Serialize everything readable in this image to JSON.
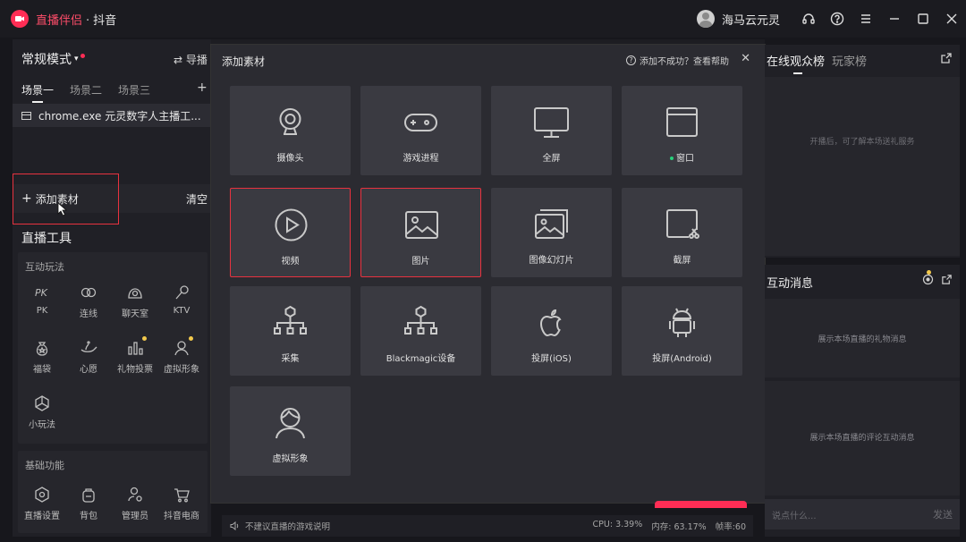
{
  "titlebar": {
    "brand": "直播伴侣",
    "separator": "·",
    "platform": "抖音",
    "username": "海马云元灵"
  },
  "left": {
    "mode": "常规模式",
    "guide": "⇄ 导播",
    "scenes": [
      "场景一",
      "场景二",
      "场景三"
    ],
    "scene_add": "+",
    "source_item": "chrome.exe 元灵数字人主播工...",
    "add_material": "添加素材",
    "add_plus": "+",
    "clear": "清空",
    "tools_title": "直播工具",
    "interactive_title": "互动玩法",
    "interactive_tools": [
      {
        "label": "PK",
        "icon": "pk-icon"
      },
      {
        "label": "连线",
        "icon": "link-icon"
      },
      {
        "label": "聊天室",
        "icon": "chatroom-icon"
      },
      {
        "label": "KTV",
        "icon": "microphone-icon"
      },
      {
        "label": "福袋",
        "icon": "lucky-bag-icon"
      },
      {
        "label": "心愿",
        "icon": "wish-lamp-icon"
      },
      {
        "label": "礼物投票",
        "icon": "gift-vote-icon"
      },
      {
        "label": "虚拟形象",
        "icon": "avatar-icon"
      },
      {
        "label": "小玩法",
        "icon": "mini-game-icon"
      }
    ],
    "basic_title": "基础功能",
    "basic_tools": [
      {
        "label": "直播设置",
        "icon": "settings-hex-icon"
      },
      {
        "label": "背包",
        "icon": "backpack-icon"
      },
      {
        "label": "管理员",
        "icon": "admin-icon"
      },
      {
        "label": "抖音电商",
        "icon": "cart-icon"
      }
    ]
  },
  "dialog": {
    "title": "添加素材",
    "help": "添加不成功？查看帮助",
    "close": "✕",
    "tiles": [
      {
        "label": "摄像头",
        "icon": "camera-icon",
        "selected": false
      },
      {
        "label": "游戏进程",
        "icon": "gamepad-icon",
        "selected": false
      },
      {
        "label": "全屏",
        "icon": "monitor-icon",
        "selected": false
      },
      {
        "label": "窗口",
        "icon": "window-icon",
        "selected": false,
        "status_dot": true
      },
      {
        "label": "视频",
        "icon": "video-play-icon",
        "selected": true
      },
      {
        "label": "图片",
        "icon": "image-icon",
        "selected": true
      },
      {
        "label": "图像幻灯片",
        "icon": "slideshow-icon",
        "selected": false
      },
      {
        "label": "截屏",
        "icon": "screenshot-icon",
        "selected": false
      },
      {
        "label": "采集",
        "icon": "capture-tree-icon",
        "selected": false
      },
      {
        "label": "Blackmagic设备",
        "icon": "blackmagic-tree-icon",
        "selected": false
      },
      {
        "label": "投屏(iOS)",
        "icon": "apple-icon",
        "selected": false
      },
      {
        "label": "投屏(Android)",
        "icon": "android-icon",
        "selected": false
      },
      {
        "label": "虚拟形象",
        "icon": "virtual-avatar-icon",
        "selected": false
      }
    ]
  },
  "right": {
    "tabs": [
      "在线观众榜",
      "玩家榜"
    ],
    "audience_hint": "开播后，可了解本场送礼服务",
    "messages_title": "互动消息",
    "gift_hint": "展示本场直播的礼物消息",
    "comment_hint": "展示本场直播的评论互动消息",
    "chat_placeholder": "说点什么...",
    "send": "发送"
  },
  "status": {
    "notice": "不建议直播的游戏说明",
    "cpu": "CPU: 3.39%",
    "memory": "内存: 63.17%",
    "fps": "帧率:60"
  },
  "colors": {
    "accent": "#ff2d55",
    "highlight_box": "#e8323f",
    "notification_dot": "#f2c94c",
    "online_dot": "#27d07a"
  }
}
